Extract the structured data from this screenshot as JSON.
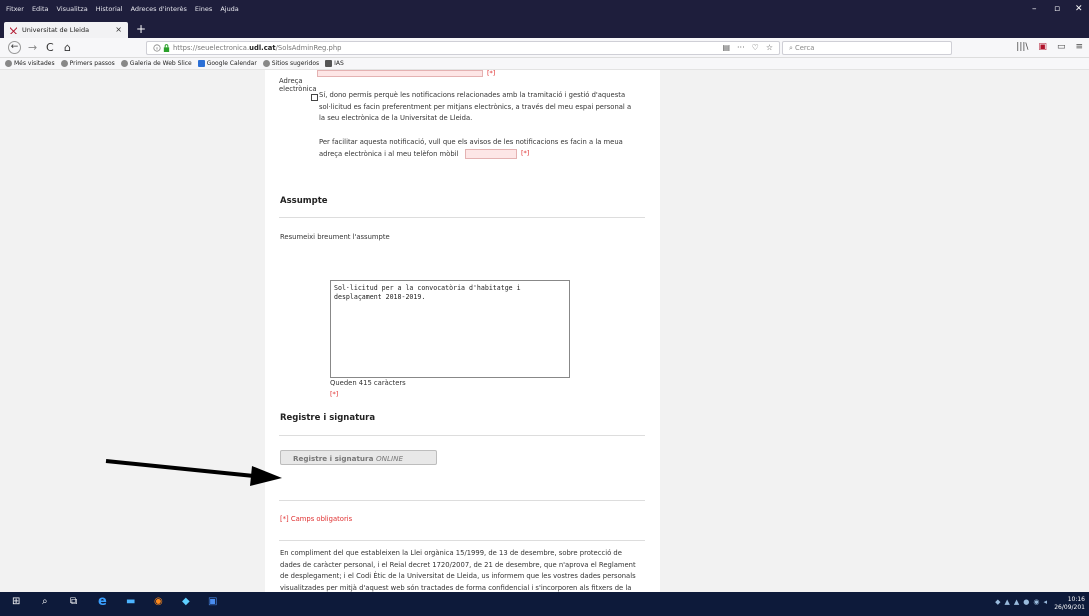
{
  "menu": [
    "Fitxer",
    "Edita",
    "Visualitza",
    "Historial",
    "Adreces d'interès",
    "Eines",
    "Ajuda"
  ],
  "window_controls": {
    "minimize": "–",
    "restore": "▫",
    "close": "✕"
  },
  "tab": {
    "title": "Universitat de Lleida",
    "close": "×",
    "new_tab": "+"
  },
  "nav": {
    "back": "←",
    "forward": "→",
    "reload": "C",
    "home": "⌂",
    "url_prefix": "https://seuelectronica.",
    "url_domain": "udl.cat",
    "url_path": "/SolsAdminReg.php",
    "url_icons": [
      "▤",
      "···",
      "♡",
      "☆"
    ],
    "search_placeholder": "Cerca",
    "right_icons": [
      "|||\\",
      "▣",
      "▭",
      "≡"
    ]
  },
  "bookmarks": [
    {
      "label": "Més visitades",
      "icon": "gear-icon"
    },
    {
      "label": "Primers passos",
      "icon": "globe-icon"
    },
    {
      "label": "Galeria de Web Slice",
      "icon": "globe-icon"
    },
    {
      "label": "Google Calendar",
      "icon": "calendar-icon"
    },
    {
      "label": "Sitios sugeridos",
      "icon": "globe-icon"
    },
    {
      "label": "IAS",
      "icon": "folder-icon"
    }
  ],
  "form": {
    "email_label_top": "Adreça",
    "email_label_bottom": "electrònica",
    "required_mark": "[*]",
    "consent_text_1": "Sí, dono permís perquè les notificacions relacionades amb la tramitació i gestió d'aquesta",
    "consent_text_2": "sol·licitud es facin preferentment per mitjans electrònics, a través del meu espai personal a",
    "consent_text_3": "la seu electrònica de la Universitat de Lleida.",
    "notify_text_1": "Per facilitar aquesta notificació, vull que els avisos de les notificacions es facin a la meua",
    "notify_text_2": "adreça electrònica i al meu telèfon mòbil",
    "subject_heading": "Assumpte",
    "subject_instruction": "Resumeixi breument l'assumpte",
    "subject_value": "Sol·licitud per a la convocatòria d'habitatge i desplaçament 2018-2019.",
    "chars_left": "Queden 415 caràcters",
    "signature_heading": "Registre i signatura",
    "signature_button": "Registre i signatura",
    "signature_button_em": "ONLINE",
    "required_note": "[*] Camps obligatoris",
    "legal_1": "En compliment del que estableixen la Llei orgànica 15/1999, de 13 de desembre, sobre protecció de",
    "legal_2": "dades de caràcter personal, i el Reial decret 1720/2007, de 21 de desembre, que n'aprova el Reglament",
    "legal_3": "de desplegament; i el Codi Ètic de la Universitat de Lleida, us informem que les vostres dades personals",
    "legal_4": "visualitzades per mitjà d'aquest web són tractades de forma confidencial i s'incorporen als fitxers de la"
  },
  "taskbar": {
    "items": [
      "⊞",
      "⌕",
      "⧉",
      "e",
      "▬",
      "◉",
      "◆",
      "▣"
    ],
    "time": "10:16",
    "date": "26/09/201"
  },
  "colors": {
    "titlebar": "#1e1e3c",
    "required": "#e03030",
    "field_bg": "#fde6e6",
    "taskbar": "#0d1a3a"
  }
}
